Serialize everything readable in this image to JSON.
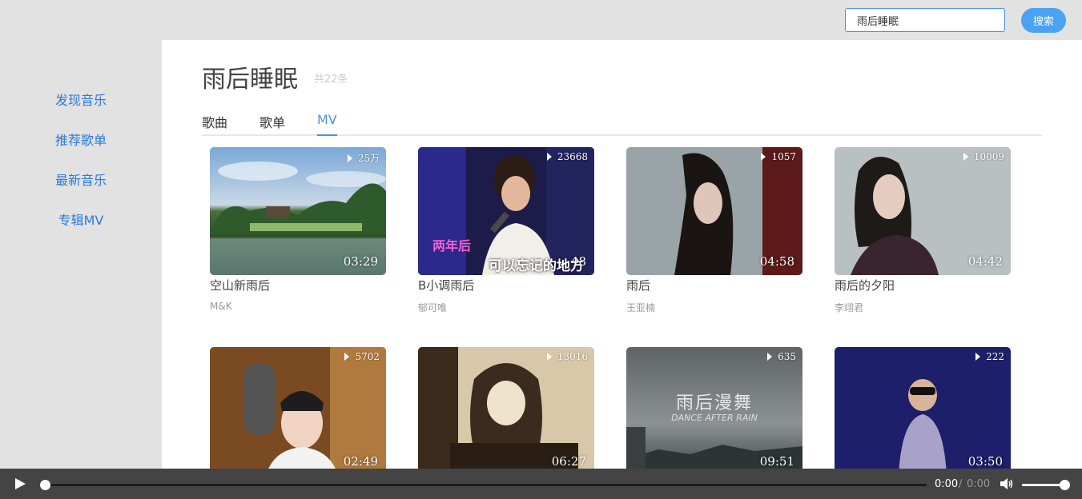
{
  "search": {
    "value": "雨后睡眠",
    "button_label": "搜索"
  },
  "sidebar": {
    "items": [
      {
        "label": "发现音乐"
      },
      {
        "label": "推荐歌单"
      },
      {
        "label": "最新音乐"
      },
      {
        "label": "专辑MV"
      }
    ]
  },
  "main": {
    "title": "雨后睡眠",
    "count": "共22条",
    "tabs": [
      {
        "label": "歌曲"
      },
      {
        "label": "歌单"
      },
      {
        "label": "MV"
      }
    ],
    "active_tab": "MV",
    "mvs": [
      {
        "name": "空山新雨后",
        "artist": "M&K",
        "plays": "25万",
        "duration": "03:29"
      },
      {
        "name": "B小调雨后",
        "artist": "郁可唯",
        "plays": "23668",
        "duration": "48",
        "caption_overlay": "可以忘记的地方",
        "caption_left": "两年后"
      },
      {
        "name": "雨后",
        "artist": "王亚楠",
        "plays": "1057",
        "duration": "04:58"
      },
      {
        "name": "雨后的夕阳",
        "artist": "李翊君",
        "plays": "10009",
        "duration": "04:42"
      },
      {
        "name": "",
        "artist": "",
        "plays": "5702",
        "duration": "02:49"
      },
      {
        "name": "",
        "artist": "",
        "plays": "13016",
        "duration": "06:27"
      },
      {
        "name": "",
        "artist": "",
        "plays": "635",
        "duration": "09:51",
        "overlay_title": "雨后漫舞",
        "overlay_sub": "DANCE AFTER RAIN"
      },
      {
        "name": "",
        "artist": "",
        "plays": "222",
        "duration": "03:50"
      }
    ]
  },
  "player": {
    "current_time": "0:00",
    "separator": "/",
    "total_time": "0:00",
    "progress": 0,
    "volume": 1
  }
}
